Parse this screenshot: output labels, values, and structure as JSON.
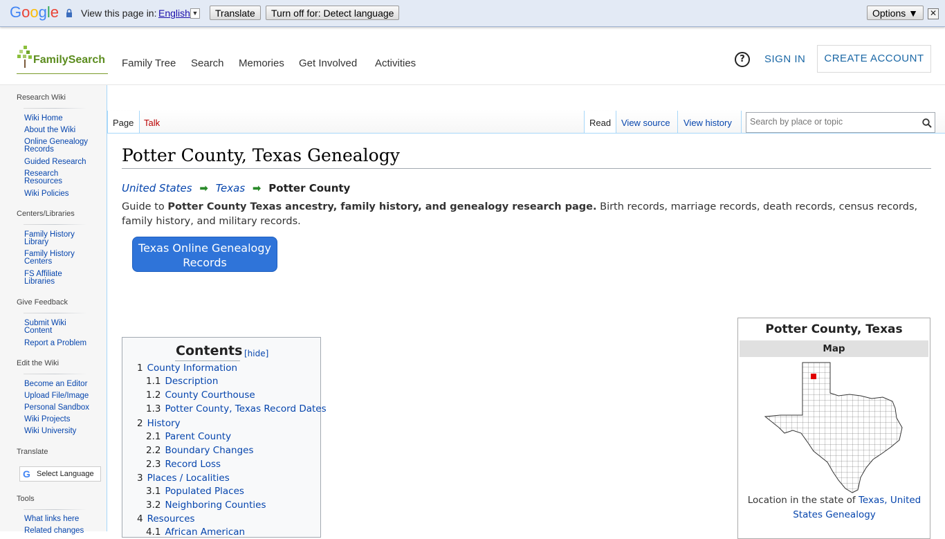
{
  "gtranslate": {
    "logo": "Google",
    "prompt": "View this page in:",
    "language": "English",
    "translate_btn": "Translate",
    "turnoff_btn": "Turn off for: Detect language",
    "options_btn": "Options ▼",
    "close": "✕"
  },
  "header": {
    "logo_text": "FamilySearch",
    "nav": [
      "Family Tree",
      "Search",
      "Memories",
      "Get Involved",
      "Activities"
    ],
    "help": "?",
    "sign_in": "SIGN IN",
    "create_account": "CREATE ACCOUNT"
  },
  "sidebar": {
    "research_wiki": "Research Wiki",
    "group1": [
      "Wiki Home",
      "About the Wiki",
      "Online Genealogy Records",
      "Guided Research",
      "Research Resources",
      "Wiki Policies"
    ],
    "centers_head": "Centers/Libraries",
    "group2": [
      "Family History Library",
      "Family History Centers",
      "FS Affiliate Libraries"
    ],
    "feedback_head": "Give Feedback",
    "group3": [
      "Submit Wiki Content",
      "Report a Problem"
    ],
    "edit_head": "Edit the Wiki",
    "group4": [
      "Become an Editor",
      "Upload File/Image",
      "Personal Sandbox",
      "Wiki Projects",
      "Wiki University"
    ],
    "translate_head": "Translate",
    "select_language": "Select Language",
    "tools_head": "Tools",
    "group5": [
      "What links here",
      "Related changes"
    ]
  },
  "tabs": {
    "page": "Page",
    "talk": "Talk",
    "read": "Read",
    "view_source": "View source",
    "view_history": "View history"
  },
  "search": {
    "placeholder": "Search by place or topic"
  },
  "article": {
    "title": "Potter County, Texas Genealogy",
    "breadcrumb": [
      "United States",
      "Texas",
      "Potter County"
    ],
    "intro_prefix": "Guide to ",
    "intro_bold": "Potter County Texas ancestry, family history, and genealogy research page.",
    "intro_rest": " Birth records, marriage records, death records, census records, family history, and military records.",
    "button": "Texas Online Genealogy Records"
  },
  "toc": {
    "title": "Contents",
    "hide": "[hide]",
    "items": [
      {
        "num": "1",
        "label": "County Information"
      },
      {
        "num": "1.1",
        "label": "Description"
      },
      {
        "num": "1.2",
        "label": "County Courthouse"
      },
      {
        "num": "1.3",
        "label": "Potter County, Texas Record Dates"
      },
      {
        "num": "2",
        "label": "History"
      },
      {
        "num": "2.1",
        "label": "Parent County"
      },
      {
        "num": "2.2",
        "label": "Boundary Changes"
      },
      {
        "num": "2.3",
        "label": "Record Loss"
      },
      {
        "num": "3",
        "label": "Places / Localities"
      },
      {
        "num": "3.1",
        "label": "Populated Places"
      },
      {
        "num": "3.2",
        "label": "Neighboring Counties"
      },
      {
        "num": "4",
        "label": "Resources"
      },
      {
        "num": "4.1",
        "label": "African American"
      }
    ]
  },
  "infobox": {
    "title": "Potter County, Texas",
    "map_header": "Map",
    "caption_prefix": "Location in the state of ",
    "caption_link": "Texas, United States Genealogy"
  }
}
